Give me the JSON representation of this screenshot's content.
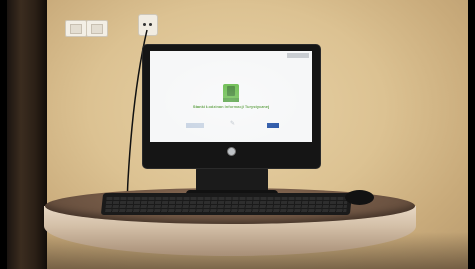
{
  "scene": {
    "description_label": "",
    "colors": {
      "wall": "#dcc292",
      "monitor": "#151515",
      "table_top": "#6d5442",
      "logo_green": "#4caf2b"
    }
  },
  "screen": {
    "title": "Stanki Łodzinan Informacji Turystycznej"
  }
}
